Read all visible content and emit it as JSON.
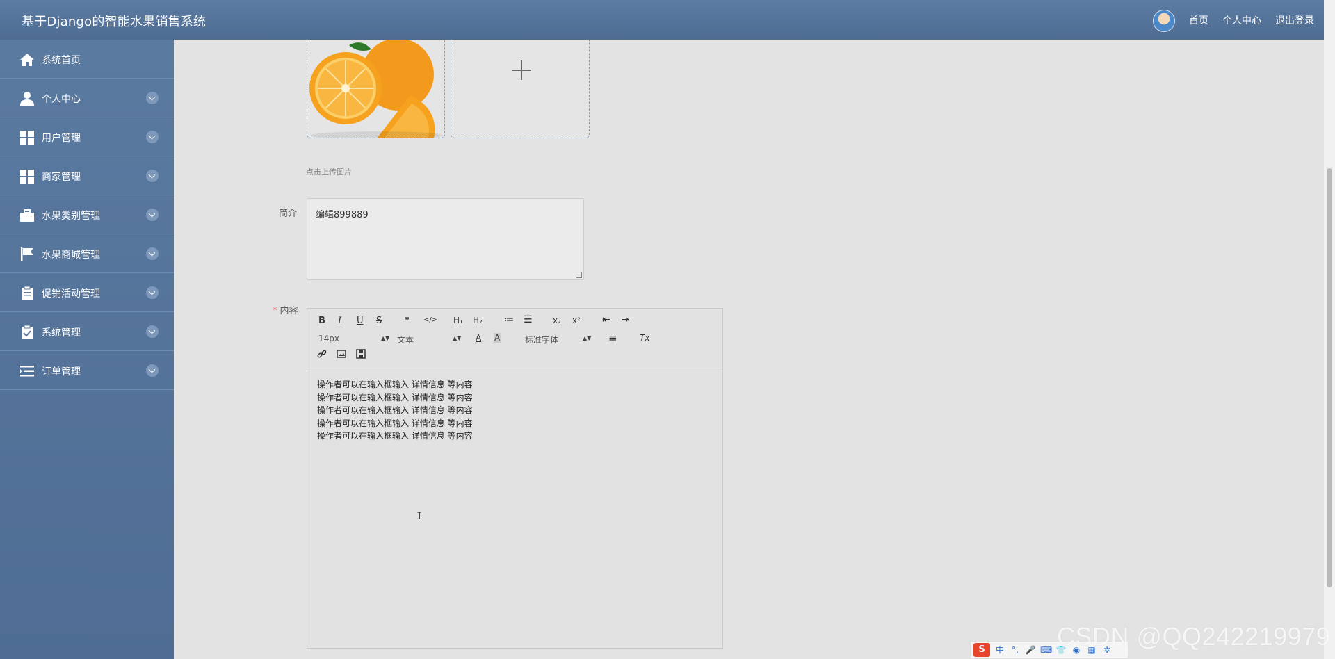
{
  "header": {
    "title": "基于Django的智能水果销售系统",
    "nav": {
      "home": "首页",
      "center": "个人中心",
      "logout": "退出登录"
    }
  },
  "sidebar": {
    "items": [
      {
        "label": "系统首页",
        "icon": "home-icon"
      },
      {
        "label": "个人中心",
        "icon": "user-icon"
      },
      {
        "label": "用户管理",
        "icon": "grid-icon"
      },
      {
        "label": "商家管理",
        "icon": "grid-icon"
      },
      {
        "label": "水果类别管理",
        "icon": "briefcase-icon"
      },
      {
        "label": "水果商城管理",
        "icon": "flag-icon"
      },
      {
        "label": "促销活动管理",
        "icon": "clipboard-icon"
      },
      {
        "label": "系统管理",
        "icon": "checklist-icon"
      },
      {
        "label": "订单管理",
        "icon": "list-icon"
      }
    ]
  },
  "form": {
    "upload_hint": "点击上传图片",
    "intro_label": "简介",
    "intro_value": "编辑899889",
    "content_required": "*",
    "content_label": "内容"
  },
  "editor": {
    "toolbar": {
      "bold": "B",
      "italic": "I",
      "underline": "U",
      "strike": "S",
      "blockquote": "❞",
      "code": "</>",
      "h1": "H₁",
      "h2": "H₂",
      "ordered_list": "≔",
      "bullet_list": "☰",
      "subscript": "x₂",
      "superscript": "x²",
      "outdent": "⇤",
      "indent": "⇥",
      "size": "14px",
      "header_select": "文本",
      "font_select": "标准字体",
      "align": "≡",
      "clean": "Tx",
      "link": "🔗",
      "image": "▣",
      "video": "▤"
    },
    "lines": [
      "操作者可以在输入框输入 详情信息 等内容",
      "操作者可以在输入框输入 详情信息 等内容",
      "操作者可以在输入框输入 详情信息 等内容",
      "操作者可以在输入框输入 详情信息 等内容",
      "操作者可以在输入框输入 详情信息 等内容"
    ]
  },
  "ime": {
    "logo": "S",
    "mode": "中"
  },
  "watermark": "CSDN @QQ242219979"
}
